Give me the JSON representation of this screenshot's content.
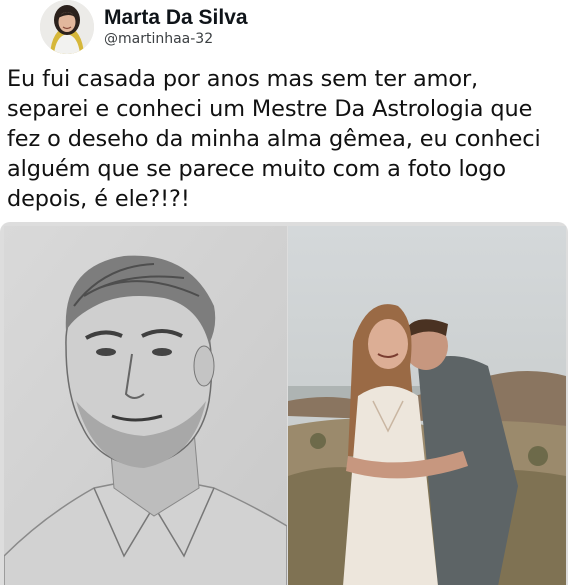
{
  "tweet": {
    "author": {
      "display_name": "Marta Da Silva",
      "handle": "@martinhaa-32"
    },
    "text": "Eu fui casada por anos mas sem ter amor,\nseparei e conheci um Mestre Da Astrologia que\nfez o deseho da minha alma gêmea, eu conheci\nalguém que se parece muito com a foto logo\ndepois, é ele?!?!",
    "media": [
      {
        "kind": "pencil-sketch",
        "subject": "man-portrait"
      },
      {
        "kind": "photo",
        "subject": "couple-embracing-outdoors"
      }
    ]
  },
  "colors": {
    "text": "#0f1419",
    "handle": "#3c4043",
    "background": "#ffffff"
  }
}
